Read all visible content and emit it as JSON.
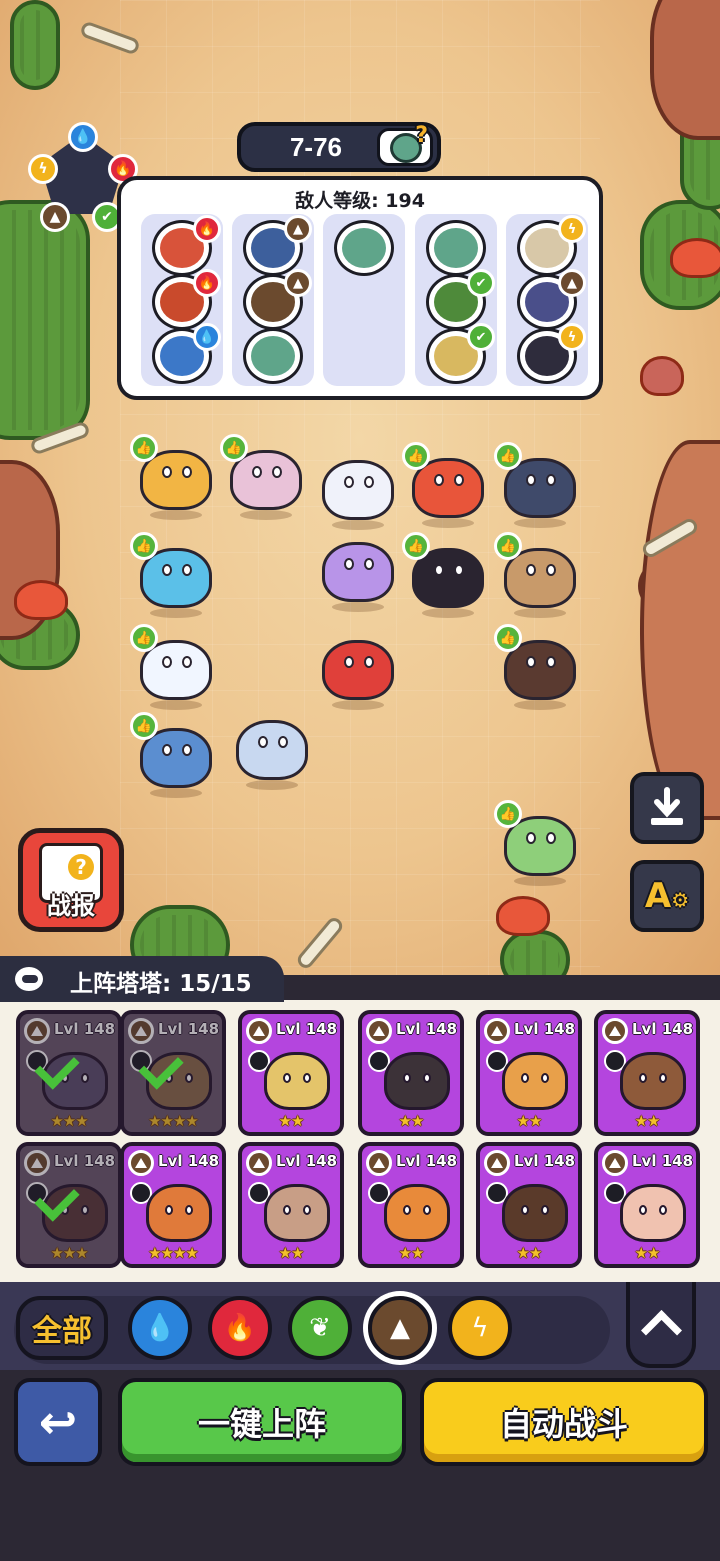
{
  "stage": {
    "label": "7-76",
    "icon": "zombie-question-icon"
  },
  "enemy_panel": {
    "title": "敌人等级: 194",
    "columns": [
      {
        "enemies": [
          {
            "element": "fire",
            "color": "#d8533a"
          },
          {
            "element": "fire",
            "color": "#c94a2c"
          },
          {
            "element": "water",
            "color": "#3c78c8"
          }
        ]
      },
      {
        "enemies": [
          {
            "element": "earth",
            "color": "#3d5f9c"
          },
          {
            "element": "earth",
            "color": "#6b4a2e"
          },
          {
            "element": "none",
            "color": "#5fa58a"
          }
        ]
      },
      {
        "enemies": [
          {
            "element": "none",
            "color": "#5fa58a"
          }
        ]
      },
      {
        "enemies": [
          {
            "element": "none",
            "color": "#5fa58a"
          },
          {
            "element": "grass",
            "color": "#4e8a3a"
          },
          {
            "element": "grass",
            "color": "#d8b860"
          }
        ]
      },
      {
        "enemies": [
          {
            "element": "elec",
            "color": "#d8c8a8"
          },
          {
            "element": "earth",
            "color": "#4a4f8a"
          },
          {
            "element": "elec",
            "color": "#2e2c3c"
          }
        ]
      }
    ]
  },
  "element_wheel": [
    "water",
    "fire",
    "grass",
    "earth",
    "elec"
  ],
  "side_buttons": {
    "report_label": "战报",
    "download_icon": "download-icon",
    "auto_settings_icon": "auto-settings-icon",
    "auto_settings_letter": "A"
  },
  "roster": {
    "title": "上阵塔塔: 15/15",
    "cards": [
      {
        "level": "Lvl 148",
        "stars": "★★★",
        "used": true,
        "color": "#5b4f6e"
      },
      {
        "level": "Lvl 148",
        "stars": "★★★★",
        "used": true,
        "color": "#8a6a4a"
      },
      {
        "level": "Lvl 148",
        "stars": "★★",
        "used": false,
        "color": "#e4c46a"
      },
      {
        "level": "Lvl 148",
        "stars": "★★",
        "used": false,
        "color": "#3c3238"
      },
      {
        "level": "Lvl 148",
        "stars": "★★",
        "used": false,
        "color": "#e8a04a"
      },
      {
        "level": "Lvl 148",
        "stars": "★★",
        "used": false,
        "color": "#8e5a3a"
      },
      {
        "level": "Lvl 148",
        "stars": "★★★",
        "used": true,
        "color": "#5a3a3a"
      },
      {
        "level": "Lvl 148",
        "stars": "★★★★",
        "used": false,
        "color": "#e07a3a"
      },
      {
        "level": "Lvl 148",
        "stars": "★★",
        "used": false,
        "color": "#c89e86"
      },
      {
        "level": "Lvl 148",
        "stars": "★★",
        "used": false,
        "color": "#e88a3a"
      },
      {
        "level": "Lvl 148",
        "stars": "★★",
        "used": false,
        "color": "#5a3a2a"
      },
      {
        "level": "Lvl 148",
        "stars": "★★",
        "used": false,
        "color": "#f0c2b0"
      }
    ]
  },
  "filters": {
    "all_label": "全部",
    "chips": [
      "water",
      "fire",
      "grass",
      "earth",
      "elec"
    ],
    "selected": "earth"
  },
  "actions": {
    "back_icon": "back-arrow-icon",
    "quick_deploy_label": "一键上阵",
    "auto_battle_label": "自动战斗"
  },
  "colors": {
    "water": "#2a84dc",
    "fire": "#e0283c",
    "grass": "#4fb038",
    "earth": "#6b4a2e",
    "elec": "#f2b31c",
    "card_purple": "#b445de"
  }
}
